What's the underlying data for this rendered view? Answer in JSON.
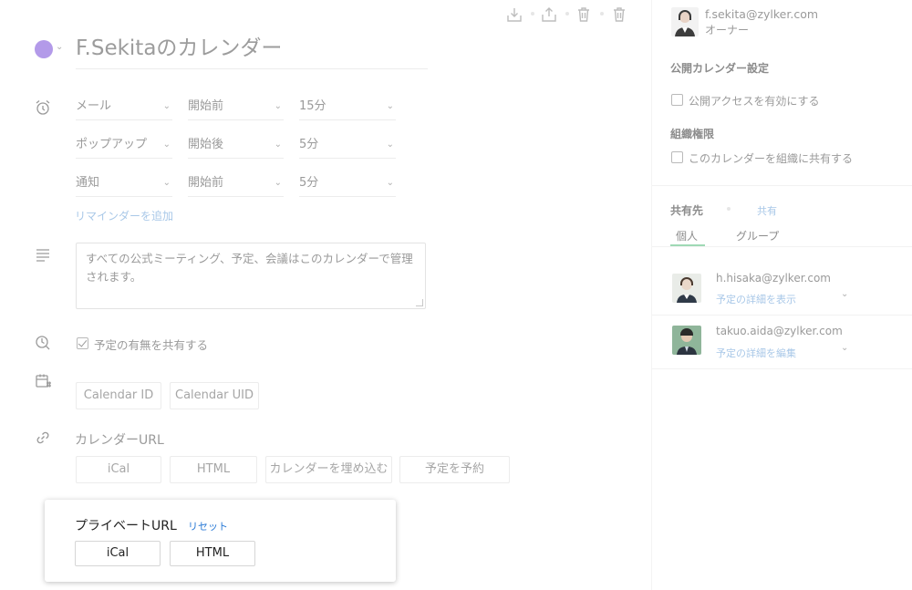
{
  "toolbar": {
    "icons": [
      "download-icon",
      "share-icon",
      "trash-outline-icon",
      "trash-icon"
    ]
  },
  "calendar": {
    "color": "#b39ae9",
    "title": "F.Sekitaのカレンダー"
  },
  "reminders": {
    "rows": [
      {
        "method": "メール",
        "timing": "開始前",
        "offset": "15分"
      },
      {
        "method": "ポップアップ",
        "timing": "開始後",
        "offset": "5分"
      },
      {
        "method": "通知",
        "timing": "開始前",
        "offset": "5分"
      }
    ],
    "add_label": "リマインダーを追加"
  },
  "description": {
    "text": "すべての公式ミーティング、予定、会議はこのカレンダーで管理されます。"
  },
  "share_availability": {
    "label": "予定の有無を共有する",
    "checked": true
  },
  "ids": {
    "calendar_id_label": "Calendar ID",
    "calendar_uid_label": "Calendar UID"
  },
  "calendar_url": {
    "heading": "カレンダーURL",
    "buttons": [
      "iCal",
      "HTML",
      "カレンダーを埋め込む",
      "予定を予約"
    ]
  },
  "private_url": {
    "heading": "プライベートURL",
    "reset_label": "リセット",
    "buttons": [
      "iCal",
      "HTML"
    ]
  },
  "owner": {
    "email": "f.sekita@zylker.com",
    "role": "オーナー"
  },
  "public_settings": {
    "heading": "公開カレンダー設定",
    "public_access_label": "公開アクセスを有効にする",
    "public_access_checked": false
  },
  "org_permissions": {
    "heading": "組織権限",
    "share_org_label": "このカレンダーを組織に共有する",
    "share_org_checked": false
  },
  "sharing": {
    "heading": "共有先",
    "share_link": "共有",
    "tabs": [
      "個人",
      "グループ"
    ],
    "active_tab": "個人",
    "users": [
      {
        "email": "h.hisaka@zylker.com",
        "permission": "予定の詳細を表示"
      },
      {
        "email": "takuo.aida@zylker.com",
        "permission": "予定の詳細を編集"
      }
    ]
  }
}
